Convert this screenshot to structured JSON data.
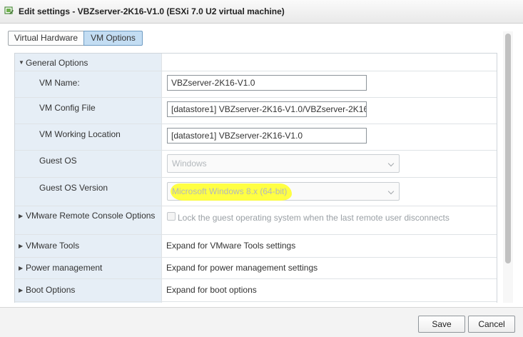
{
  "window": {
    "title": "Edit settings - VBZserver-2K16-V1.0 (ESXi 7.0 U2 virtual machine)",
    "icon": "vm-edit-icon"
  },
  "tabs": [
    {
      "label": "Virtual Hardware",
      "active": false
    },
    {
      "label": "VM Options",
      "active": true
    }
  ],
  "general": {
    "header": "General Options",
    "vm_name_label": "VM Name:",
    "vm_name_value": "VBZserver-2K16-V1.0",
    "config_file_label": "VM Config File",
    "config_file_value": "[datastore1] VBZserver-2K16-V1.0/VBZserver-2K16-V",
    "working_location_label": "VM Working Location",
    "working_location_value": "[datastore1] VBZserver-2K16-V1.0",
    "guest_os_label": "Guest OS",
    "guest_os_value": "Windows",
    "guest_os_version_label": "Guest OS Version",
    "guest_os_version_value": "Microsoft Windows 8.x (64-bit)"
  },
  "remote_console": {
    "label": "VMware Remote Console Options",
    "checkbox_label": "Lock the guest operating system when the last remote user disconnects",
    "checked": false
  },
  "sections": [
    {
      "label": "VMware Tools",
      "value": "Expand for VMware Tools settings"
    },
    {
      "label": "Power management",
      "value": "Expand for power management settings"
    },
    {
      "label": "Boot Options",
      "value": "Expand for boot options"
    }
  ],
  "footer": {
    "save_label": "Save",
    "cancel_label": "Cancel"
  },
  "colors": {
    "active_tab": "#c3ddf3",
    "label_column": "#e6eef6",
    "highlight": "#ffff33"
  }
}
